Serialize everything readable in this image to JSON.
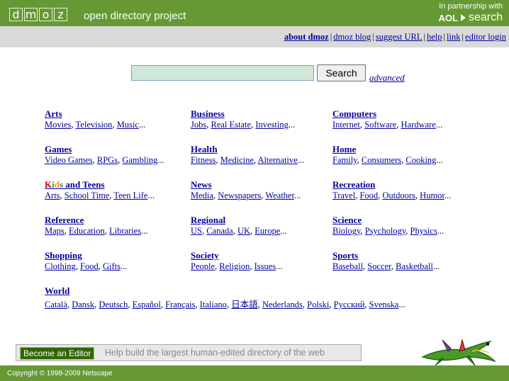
{
  "header": {
    "logo_letters": [
      "d",
      "m",
      "o",
      "z"
    ],
    "site_name": "open directory project",
    "partner_text": "In partnership with",
    "partner_brand": "AOL",
    "partner_product": "search",
    "bar_color": "#669933"
  },
  "nav": {
    "links": [
      "about dmoz",
      "dmoz blog",
      "suggest URL",
      "help",
      "link",
      "editor login"
    ]
  },
  "search": {
    "input_value": "",
    "button_label": "Search",
    "advanced_label": "advanced"
  },
  "categories": [
    {
      "title": "Arts",
      "subs": [
        "Movies",
        "Television",
        "Music"
      ]
    },
    {
      "title": "Business",
      "subs": [
        "Jobs",
        "Real Estate",
        "Investing"
      ]
    },
    {
      "title": "Computers",
      "subs": [
        "Internet",
        "Software",
        "Hardware"
      ]
    },
    {
      "title": "Games",
      "subs": [
        "Video Games",
        "RPGs",
        "Gambling"
      ]
    },
    {
      "title": "Health",
      "subs": [
        "Fitness",
        "Medicine",
        "Alternative"
      ]
    },
    {
      "title": "Home",
      "subs": [
        "Family",
        "Consumers",
        "Cooking"
      ]
    },
    {
      "title": "Kids and Teens",
      "title_kids": [
        "K",
        "i",
        "d",
        "s"
      ],
      "title_rest": " and Teens",
      "subs": [
        "Arts",
        "School Time",
        "Teen Life"
      ]
    },
    {
      "title": "News",
      "subs": [
        "Media",
        "Newspapers",
        "Weather"
      ]
    },
    {
      "title": "Recreation",
      "subs": [
        "Travel",
        "Food",
        "Outdoors",
        "Humor"
      ]
    },
    {
      "title": "Reference",
      "subs": [
        "Maps",
        "Education",
        "Libraries"
      ]
    },
    {
      "title": "Regional",
      "subs": [
        "US",
        "Canada",
        "UK",
        "Europe"
      ]
    },
    {
      "title": "Science",
      "subs": [
        "Biology",
        "Psychology",
        "Physics"
      ]
    },
    {
      "title": "Shopping",
      "subs": [
        "Clothing",
        "Food",
        "Gifts"
      ]
    },
    {
      "title": "Society",
      "subs": [
        "People",
        "Religion",
        "Issues"
      ]
    },
    {
      "title": "Sports",
      "subs": [
        "Baseball",
        "Soccer",
        "Basketball"
      ]
    },
    {
      "title": "World",
      "subs": [
        "Català",
        "Dansk",
        "Deutsch",
        "Español",
        "Français",
        "Italiano",
        "日本語",
        "Nederlands",
        "Polski",
        "Русский",
        "Svenska"
      ]
    }
  ],
  "ellipsis": "...",
  "editor": {
    "button_label": "Become an Editor",
    "tagline": "Help build the largest human-edited directory of the web"
  },
  "footer": {
    "copyright": "Copyright © 1998-2009 Netscape"
  },
  "mascot_icon": "lizard-mascot-icon"
}
